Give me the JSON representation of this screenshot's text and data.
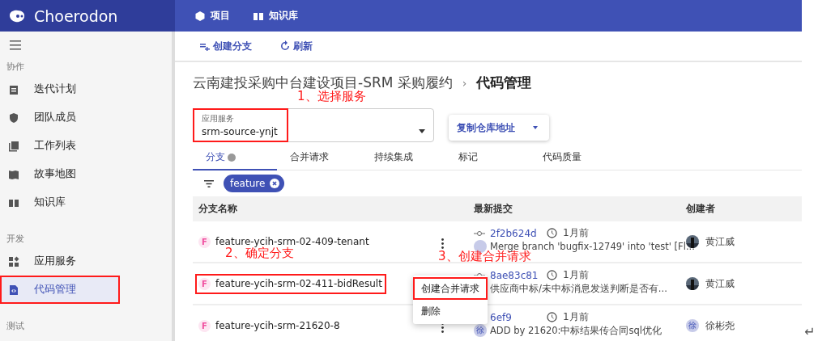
{
  "header": {
    "logo": "Choerodon",
    "nav": [
      {
        "label": "项目"
      },
      {
        "label": "知识库"
      }
    ]
  },
  "sidebar": {
    "groups": [
      {
        "title": "协作",
        "items": [
          {
            "label": "迭代计划",
            "selected": false,
            "highlighted": false
          },
          {
            "label": "团队成员",
            "selected": false,
            "highlighted": false
          },
          {
            "label": "工作列表",
            "selected": false,
            "highlighted": false
          },
          {
            "label": "故事地图",
            "selected": false,
            "highlighted": false
          },
          {
            "label": "知识库",
            "selected": false,
            "highlighted": false
          }
        ]
      },
      {
        "title": "开发",
        "items": [
          {
            "label": "应用服务",
            "selected": false,
            "highlighted": false
          },
          {
            "label": "代码管理",
            "selected": true,
            "highlighted": true
          }
        ]
      },
      {
        "title": "测试"
      }
    ]
  },
  "toolbar": [
    "创建分支",
    "刷新"
  ],
  "breadcrumb": {
    "parent": "云南建投采购中台建设项目-SRM 采购履约",
    "separator": "›",
    "current": "代码管理"
  },
  "service_select": {
    "label": "应用服务",
    "value": "srm-source-ynjt",
    "highlighted": true
  },
  "copy_button": "复制仓库地址",
  "tabs": [
    {
      "label": "分支",
      "selected": true,
      "help": true
    },
    {
      "label": "合并请求",
      "selected": false,
      "help": false
    },
    {
      "label": "持续集成",
      "selected": false,
      "help": false
    },
    {
      "label": "标记",
      "selected": false,
      "help": false
    },
    {
      "label": "代码质量",
      "selected": false,
      "help": false
    }
  ],
  "filter_chips": [
    "feature"
  ],
  "table": {
    "columns": [
      "分支名称",
      "最新提交",
      "创建者"
    ],
    "rows": [
      {
        "branch_badge": "F",
        "branch": "feature-ycih-srm-02-409-tenant",
        "highlighted": false,
        "hash": "2f2b624d",
        "time": "1月前",
        "avatar": {
          "kind": "blank"
        },
        "message": "Merge branch 'bugfix-12749' into 'test' [Fl...",
        "creator": "黄江威"
      },
      {
        "branch_badge": "F",
        "branch": "feature-ycih-srm-02-411-bidResult",
        "highlighted": true,
        "hash": "8ae83c81",
        "time": "1月前",
        "message": "供应商中标/未中标消息发送判断是否有...",
        "creator": "黄江威"
      },
      {
        "branch_badge": "F",
        "branch": "feature-ycih-srm-21620-8",
        "highlighted": false,
        "hash": "6ef9",
        "time": "1月前",
        "avatar": {
          "kind": "initial",
          "text": "徐"
        },
        "message": "ADD by 21620:中标结果传合同sql优化",
        "creator": "徐彬尧",
        "creator_avatar": {
          "kind": "initial",
          "text": "徐"
        }
      }
    ]
  },
  "row_menu": {
    "items": [
      {
        "label": "创建合并请求",
        "highlighted": true
      },
      {
        "label": "删除",
        "highlighted": false
      }
    ]
  },
  "annotations": [
    "1、选择服务",
    "2、确定分支",
    "3、创建合并请求"
  ],
  "return_mark": "↵"
}
